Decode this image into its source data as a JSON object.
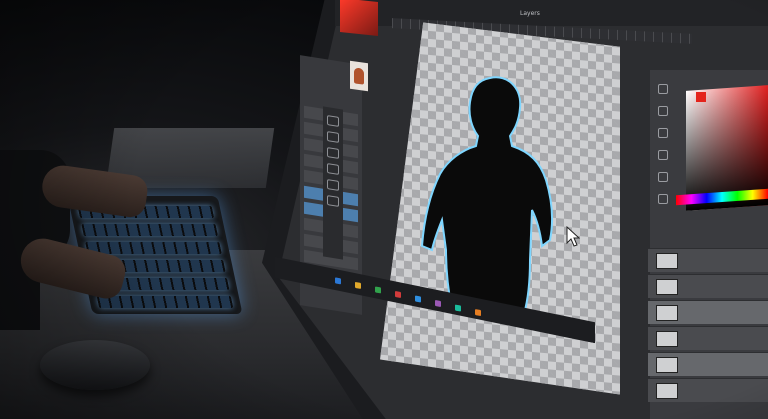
{
  "window": {
    "title": "Layers"
  },
  "scene": {
    "description_icons": [
      "keyboard",
      "mouse",
      "hands",
      "monitor",
      "cursor-arrow-icon"
    ]
  },
  "colors": {
    "accent_red": "#e4231b",
    "selection_blue": "#4d7fae",
    "keyboard_glow": "#78beff",
    "panel_gray": "#3a3b3f",
    "silhouette_outline": "#7fd6ff"
  }
}
